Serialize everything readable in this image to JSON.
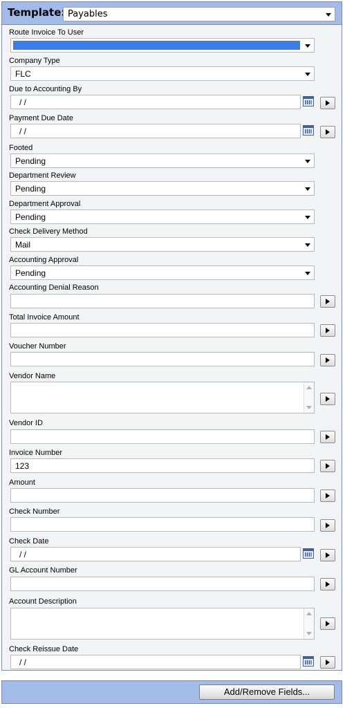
{
  "template": {
    "label": "Template:",
    "value": "Payables"
  },
  "fields": [
    {
      "label": "Route Invoice To User",
      "value": ""
    },
    {
      "label": "Company Type",
      "value": "FLC"
    },
    {
      "label": "Due to Accounting By",
      "value": "/ /"
    },
    {
      "label": "Payment Due Date",
      "value": "/ /"
    },
    {
      "label": "Footed",
      "value": "Pending"
    },
    {
      "label": "Department Review",
      "value": "Pending"
    },
    {
      "label": "Department Approval",
      "value": "Pending"
    },
    {
      "label": "Check Delivery Method",
      "value": "Mail"
    },
    {
      "label": "Accounting Approval",
      "value": "Pending"
    },
    {
      "label": "Accounting Denial Reason",
      "value": ""
    },
    {
      "label": "Total Invoice Amount",
      "value": ""
    },
    {
      "label": "Voucher Number",
      "value": ""
    },
    {
      "label": "Vendor Name",
      "value": ""
    },
    {
      "label": "Vendor ID",
      "value": ""
    },
    {
      "label": "Invoice Number",
      "value": "123"
    },
    {
      "label": "Amount",
      "value": ""
    },
    {
      "label": "Check Number",
      "value": ""
    },
    {
      "label": "Check Date",
      "value": "/ /"
    },
    {
      "label": "GL Account Number",
      "value": ""
    },
    {
      "label": "Account Description",
      "value": ""
    },
    {
      "label": "Check Reissue Date",
      "value": "/ /"
    }
  ],
  "footer": {
    "add_remove_label": "Add/Remove Fields..."
  },
  "colors": {
    "header_bar": "#a3bbe8",
    "selection": "#3a7de9"
  }
}
